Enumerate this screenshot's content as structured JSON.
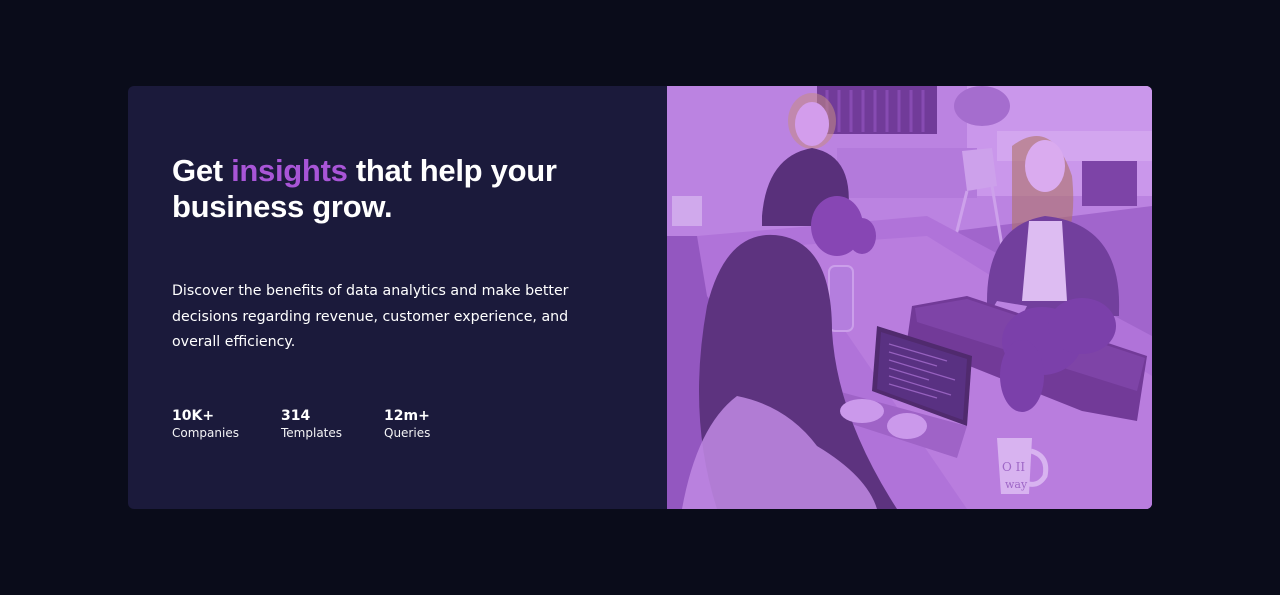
{
  "hero": {
    "headline_before": "Get ",
    "headline_accent": "insights",
    "headline_after": " that help your business grow.",
    "description": "Discover the benefits of data analytics and make better decisions regarding revenue, customer experience, and overall efficiency."
  },
  "stats": [
    {
      "value": "10K+",
      "label": "Companies"
    },
    {
      "value": "314",
      "label": "Templates"
    },
    {
      "value": "12m+",
      "label": "Queries"
    }
  ],
  "image": {
    "subject": "office-team-photo",
    "tint_color": "#aa5cdb",
    "mug_text_line1": "O II",
    "mug_text_line2": "way"
  },
  "colors": {
    "page_background": "#0a0c1a",
    "card_background": "#1b1a3b",
    "accent": "#a855d7",
    "text": "#ffffff"
  }
}
